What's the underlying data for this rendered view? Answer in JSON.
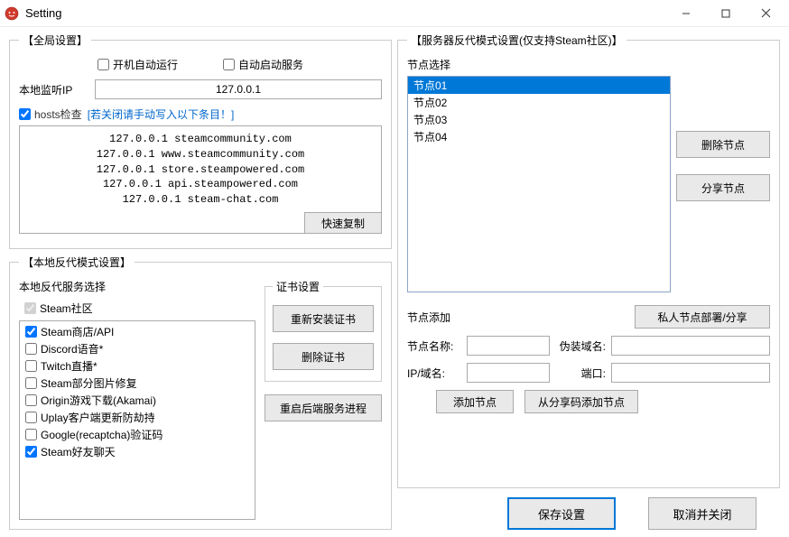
{
  "window": {
    "title": "Setting"
  },
  "global": {
    "legend": "【全局设置】",
    "autorun_label": "开机自动运行",
    "autorun": false,
    "autostart_label": "自动启动服务",
    "autostart": false,
    "listen_ip_label": "本地监听IP",
    "listen_ip": "127.0.0.1",
    "hosts_check": true,
    "hosts_check_label": "hosts检查",
    "hosts_hint": "[若关闭请手动写入以下条目！]",
    "hosts_text": "127.0.0.1 steamcommunity.com\n127.0.0.1 www.steamcommunity.com\n127.0.0.1 store.steampowered.com\n127.0.0.1 api.steampowered.com\n127.0.0.1 steam-chat.com",
    "quick_copy": "快速复制"
  },
  "local_proxy": {
    "legend": "【本地反代模式设置】",
    "service_label": "本地反代服务选择",
    "services": [
      {
        "label": "Steam社区",
        "checked": true,
        "disabled": true
      },
      {
        "label": "Steam商店/API",
        "checked": true,
        "disabled": false
      },
      {
        "label": "Discord语音*",
        "checked": false,
        "disabled": false
      },
      {
        "label": "Twitch直播*",
        "checked": false,
        "disabled": false
      },
      {
        "label": "Steam部分图片修复",
        "checked": false,
        "disabled": false
      },
      {
        "label": "Origin游戏下载(Akamai)",
        "checked": false,
        "disabled": false
      },
      {
        "label": "Uplay客户端更新防劫持",
        "checked": false,
        "disabled": false
      },
      {
        "label": "Google(recaptcha)验证码",
        "checked": false,
        "disabled": false
      },
      {
        "label": "Steam好友聊天",
        "checked": true,
        "disabled": false
      }
    ],
    "cert_legend": "证书设置",
    "reinstall_cert": "重新安装证书",
    "delete_cert": "删除证书",
    "restart_backend": "重启后端服务进程"
  },
  "server_proxy": {
    "legend": "【服务器反代模式设置(仅支持Steam社区)】",
    "node_select_label": "节点选择",
    "nodes": [
      {
        "label": "节点01",
        "selected": true
      },
      {
        "label": "节点02",
        "selected": false
      },
      {
        "label": "节点03",
        "selected": false
      },
      {
        "label": "节点04",
        "selected": false
      }
    ],
    "delete_node": "删除节点",
    "share_node": "分享节点",
    "node_add_label": "节点添加",
    "private_node_deploy": "私人节点部署/分享",
    "node_name_label": "节点名称:",
    "node_name": "",
    "fake_domain_label": "伪装域名:",
    "fake_domain": "",
    "ip_domain_label": "IP/域名:",
    "ip_domain": "",
    "port_label": "端口:",
    "port": "",
    "add_node": "添加节点",
    "add_from_share": "从分享码添加节点"
  },
  "actions": {
    "save": "保存设置",
    "cancel": "取消并关闭"
  }
}
